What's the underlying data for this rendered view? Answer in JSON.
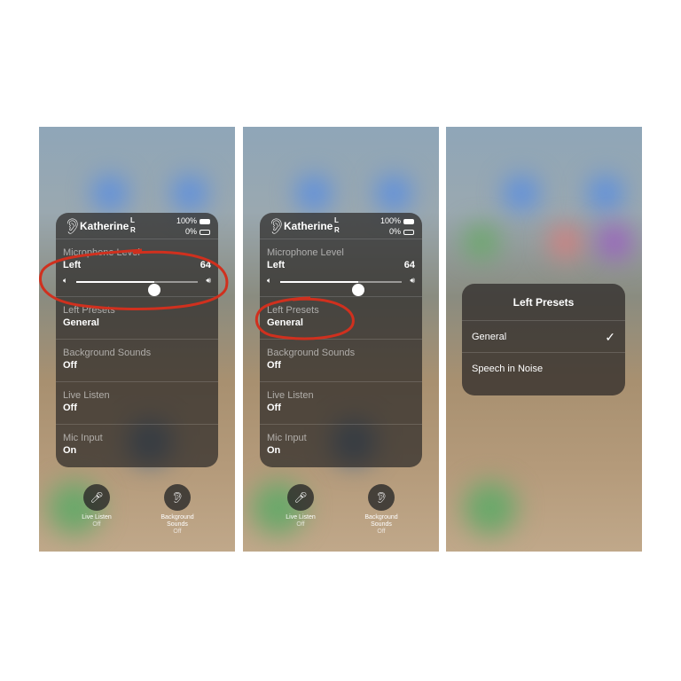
{
  "device": {
    "name": "Katherine",
    "left": "L",
    "right": "R",
    "battery_left": "100%",
    "battery_right": "0%"
  },
  "mic_level": {
    "label": "Microphone Level",
    "side": "Left",
    "value": "64",
    "level": 64
  },
  "rows": [
    {
      "label": "Left Presets",
      "value": "General"
    },
    {
      "label": "Background Sounds",
      "value": "Off"
    },
    {
      "label": "Live Listen",
      "value": "Off"
    },
    {
      "label": "Mic Input",
      "value": "On"
    }
  ],
  "controls": {
    "live_listen": {
      "label": "Live Listen",
      "state": "Off"
    },
    "background_sounds": {
      "label": "Background Sounds",
      "state": "Off"
    }
  },
  "dialog": {
    "title": "Left Presets",
    "options": [
      {
        "label": "General",
        "selected": true
      },
      {
        "label": "Speech in Noise",
        "selected": false
      }
    ],
    "check": "✓"
  },
  "annotation_color": "#d0301e"
}
